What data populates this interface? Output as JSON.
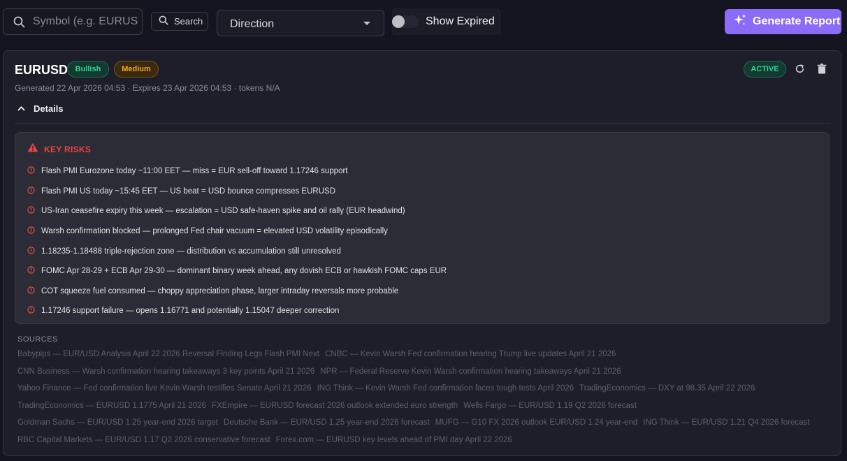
{
  "toolbar": {
    "symbol_placeholder": "Symbol (e.g. EURUSD)",
    "search_label": "Search",
    "direction_label": "Direction",
    "show_expired_label": "Show Expired",
    "generate_label": "Generate Report"
  },
  "report": {
    "symbol": "EURUSD",
    "direction_badge": "Bullish",
    "confidence_badge": "Medium",
    "status_badge": "ACTIVE",
    "meta": "Generated 22 Apr 2026 04:53 · Expires 23 Apr 2026 04:53 · tokens N/A",
    "details_label": "Details",
    "key_risks_title": "KEY RISKS",
    "key_risks": [
      "Flash PMI Eurozone today ~11:00 EET — miss = EUR sell-off toward 1.17246 support",
      "Flash PMI US today ~15:45 EET — US beat = USD bounce compresses EURUSD",
      "US-Iran ceasefire expiry this week — escalation = USD safe-haven spike and oil rally (EUR headwind)",
      "Warsh confirmation blocked — prolonged Fed chair vacuum = elevated USD volatility episodically",
      "1.18235-1.18488 triple-rejection zone — distribution vs accumulation still unresolved",
      "FOMC Apr 28-29 + ECB Apr 29-30 — dominant binary week ahead, any dovish ECB or hawkish FOMC caps EUR",
      "COT squeeze fuel consumed — choppy appreciation phase, larger intraday reversals more probable",
      "1.17246 support failure — opens 1.16771 and potentially 1.15047 deeper correction"
    ],
    "sources_title": "SOURCES",
    "sources": [
      "Babypips — EUR/USD Analysis April 22 2026 Reversal Finding Legs Flash PMI Next",
      "CNBC — Kevin Warsh Fed confirmation hearing Trump live updates April 21 2026",
      "CNN Business — Warsh confirmation hearing takeaways 3 key points April 21 2026",
      "NPR — Federal Reserve Kevin Warsh confirmation hearing takeaways April 21 2026",
      "Yahoo Finance — Fed confirmation live Kevin Warsh testifies Senate April 21 2026",
      "ING Think — Kevin Warsh Fed confirmation faces tough tests April 2026",
      "TradingEconomics — DXY at 98.35 April 22 2026",
      "TradingEconomics — EURUSD 1.1775 April 21 2026",
      "FXEmpire — EURUSD forecast 2026 outlook extended euro strength",
      "Wells Fargo — EUR/USD 1.19 Q2 2026 forecast",
      "Goldman Sachs — EUR/USD 1.25 year-end 2026 target",
      "Deutsche Bank — EUR/USD 1.25 year-end 2026 forecast",
      "MUFG — G10 FX 2026 outlook EUR/USD 1.24 year-end",
      "ING Think — EUR/USD 1.21 Q4 2026 forecast",
      "RBC Capital Markets — EUR/USD 1.17 Q2 2026 conservative forecast",
      "Forex.com — EURUSD key levels ahead of PMI day April 22 2026"
    ]
  },
  "colors": {
    "accent": "#8b6cf6",
    "bullish": "#34d399",
    "medium": "#f5a524",
    "risk": "#ef4444"
  },
  "icons": [
    "search-icon",
    "chevron-down-icon",
    "sparkles-icon",
    "refresh-icon",
    "trash-icon",
    "chevron-up-icon",
    "warning-triangle-icon",
    "alert-circle-icon"
  ]
}
